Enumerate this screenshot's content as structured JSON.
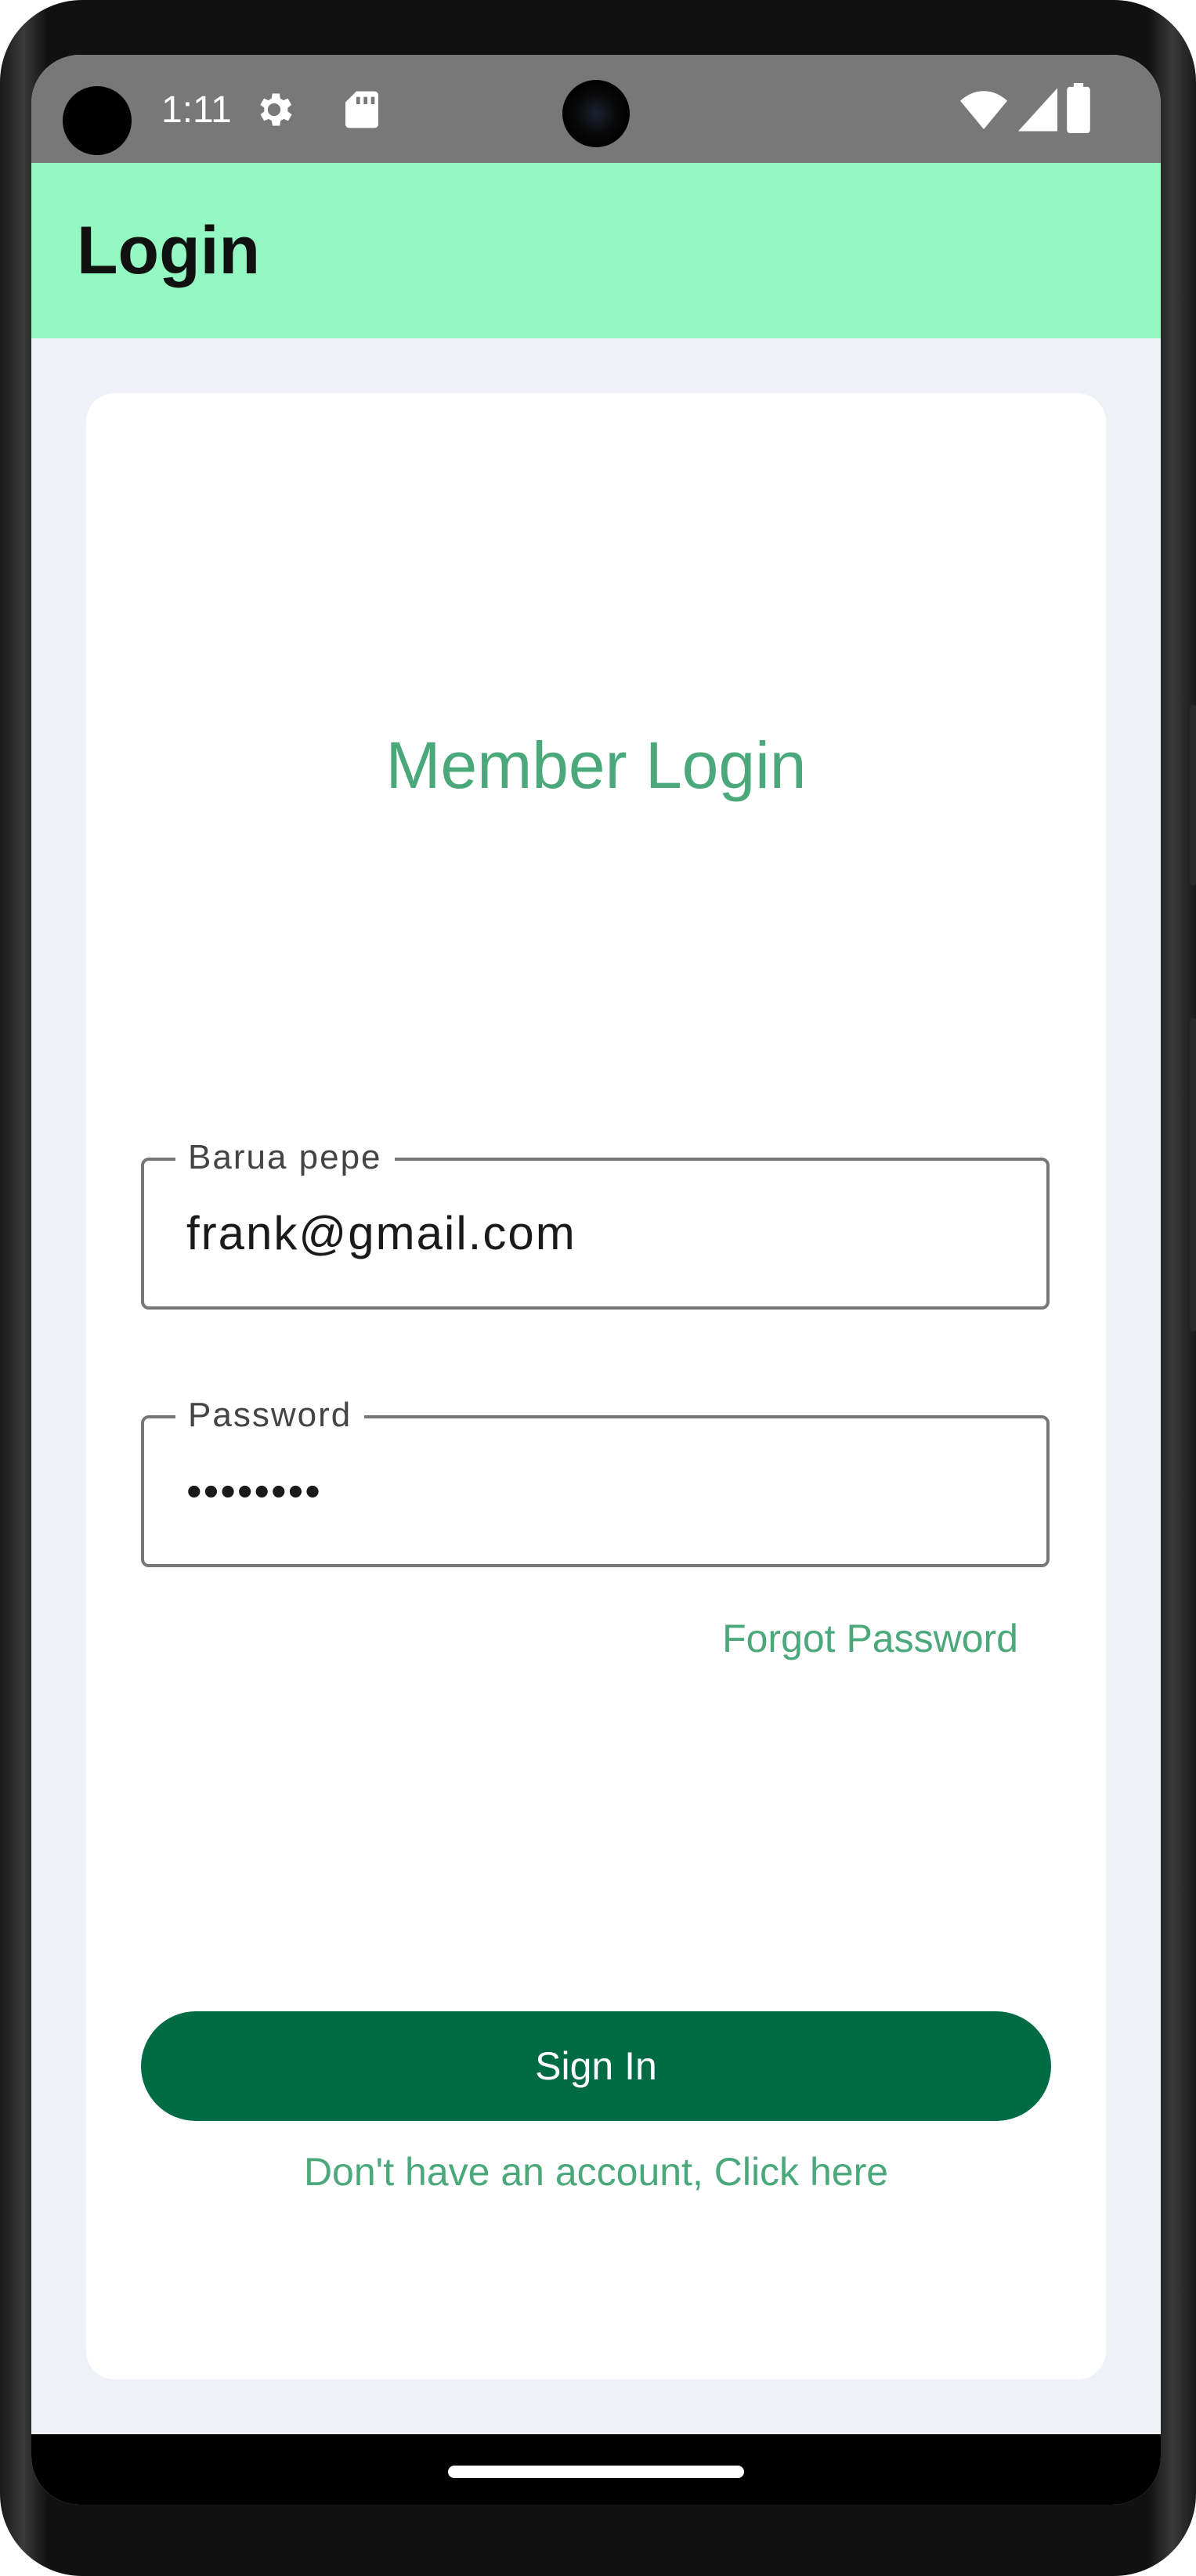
{
  "status_bar": {
    "time": "1:11",
    "icons": [
      "settings-gear-icon",
      "sd-card-icon",
      "wifi-icon",
      "cell-signal-icon",
      "battery-icon"
    ]
  },
  "app_bar": {
    "title": "Login",
    "background_color": "#93f8c2"
  },
  "login_form": {
    "heading": "Member Login",
    "email_field": {
      "label": "Barua pepe",
      "value": "frank@gmail.com"
    },
    "password_field": {
      "label": "Password",
      "value": "••••••••"
    },
    "forgot_password_label": "Forgot Password",
    "sign_in_label": "Sign In",
    "register_link_label": "Don't have an account, Click here"
  },
  "colors": {
    "accent": "#4ba87a",
    "primary_button": "#006b45",
    "screen_background": "#eff0f8"
  }
}
